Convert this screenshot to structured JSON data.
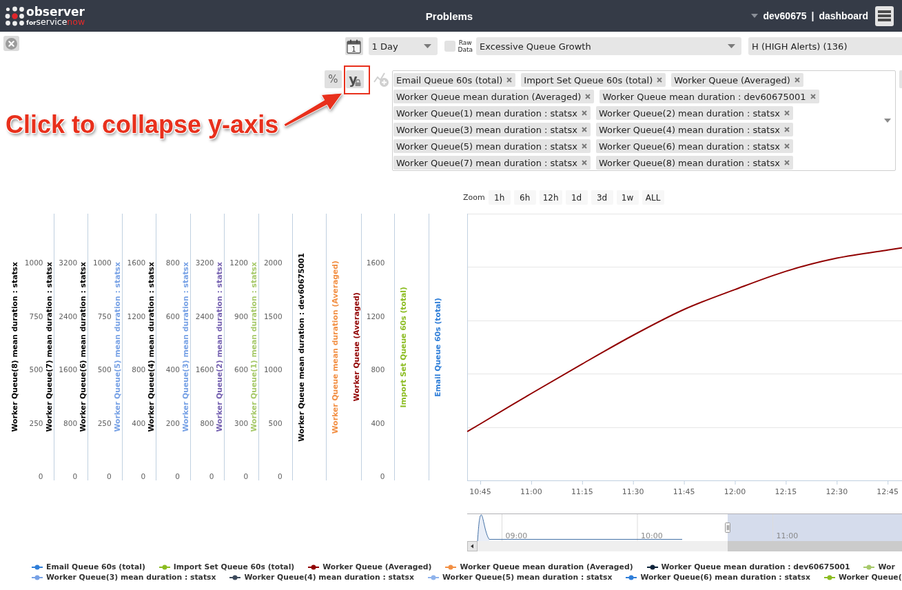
{
  "header": {
    "logo": {
      "wordmark": "observer",
      "tagline_prefix": "for",
      "tagline": "service",
      "tagline_accent": "now"
    },
    "title": "Problems",
    "user": "dev60675",
    "separator": "|",
    "link": "dashboard"
  },
  "filters": {
    "calendar_day": "1",
    "period": "1 Day",
    "raw_data": {
      "label": "Raw Data",
      "checked": false
    },
    "problem": "Excessive Queue Growth",
    "severity": "H (HIGH Alerts) (136)"
  },
  "series_tools": {
    "percent": "%",
    "y_axis": "y",
    "add_series": {
      "disabled": true
    },
    "selected_series": [
      "Email Queue 60s (total)",
      "Import Set Queue 60s (total)",
      "Worker Queue (Averaged)",
      "Worker Queue mean duration (Averaged)",
      "Worker Queue mean duration : dev60675001",
      "Worker Queue(1) mean duration : statsx",
      "Worker Queue(2) mean duration : statsx",
      "Worker Queue(3) mean duration : statsx",
      "Worker Queue(4) mean duration : statsx",
      "Worker Queue(5) mean duration : statsx",
      "Worker Queue(6) mean duration : statsx",
      "Worker Queue(7) mean duration : statsx",
      "Worker Queue(8) mean duration : statsx"
    ]
  },
  "annotation": {
    "text": "Click to collapse y-axis"
  },
  "chart": {
    "zoom_label": "Zoom",
    "zoom_buttons": [
      {
        "label": "1h",
        "selected": false
      },
      {
        "label": "6h",
        "selected": false
      },
      {
        "label": "12h",
        "selected": false
      },
      {
        "label": "1d",
        "selected": false
      },
      {
        "label": "3d",
        "selected": false
      },
      {
        "label": "1w",
        "selected": false
      },
      {
        "label": "ALL",
        "selected": false
      }
    ],
    "y_axes": [
      {
        "kind": "scale",
        "title": "Worker Queue(8) mean duration : statsx",
        "color": "#000000",
        "ticks": [
          "1000",
          "750",
          "500",
          "250",
          "0"
        ]
      },
      {
        "kind": "scale",
        "title": "Worker Queue(7) mean duration : statsx",
        "color": "#000000",
        "ticks": [
          "3200",
          "2400",
          "1600",
          "800",
          "0"
        ]
      },
      {
        "kind": "scale",
        "title": "Worker Queue(6) mean duration : statsx",
        "color": "#000000",
        "ticks": [
          "1000",
          "750",
          "500",
          "250",
          "0"
        ]
      },
      {
        "kind": "scale",
        "title": "Worker Queue(5) mean duration : statsx",
        "color": "#77a1e5",
        "ticks": [
          "1600",
          "1200",
          "800",
          "400",
          "0"
        ]
      },
      {
        "kind": "scale",
        "title": "Worker Queue(4) mean duration : statsx",
        "color": "#000000",
        "ticks": [
          "800",
          "600",
          "400",
          "200",
          "0"
        ]
      },
      {
        "kind": "scale",
        "title": "Worker Queue(3) mean duration : statsx",
        "color": "#77a1e5",
        "ticks": [
          "3200",
          "2400",
          "1600",
          "800",
          "0"
        ]
      },
      {
        "kind": "scale",
        "title": "Worker Queue(2) mean duration : statsx",
        "color": "#7460b0",
        "ticks": [
          "1200",
          "900",
          "600",
          "300",
          "0"
        ]
      },
      {
        "kind": "scale",
        "title": "Worker Queue(1) mean duration : statsx",
        "color": "#a6c96a",
        "ticks": [
          "2000",
          "1500",
          "1000",
          "500",
          "0"
        ]
      },
      {
        "kind": "plain",
        "title": "Worker Queue mean duration : dev60675001",
        "color": "#000000"
      },
      {
        "kind": "plain",
        "title": "Worker Queue mean duration (Averaged)",
        "color": "#f28f43"
      },
      {
        "kind": "scale",
        "title": "Worker Queue (Averaged)",
        "color": "#910000",
        "ticks": [
          "1600",
          "1200",
          "800",
          "400",
          "0"
        ]
      },
      {
        "kind": "plain",
        "title": "Import Set Queue 60s (total)",
        "color": "#8bbc21"
      },
      {
        "kind": "plain",
        "title": "Email Queue 60s (total)",
        "color": "#2f7ed8"
      }
    ],
    "plot": {
      "x_labels": [
        "10:45",
        "11:00",
        "11:15",
        "11:30",
        "11:45",
        "12:00",
        "12:15",
        "12:30",
        "12:45"
      ]
    },
    "navigator": {
      "labels": [
        "09:00",
        "10:00",
        "11:00"
      ]
    },
    "legend": {
      "rows": [
        {
          "items": [
            {
              "label": "Email Queue 60s (total)",
              "color": "#2f7ed8"
            },
            {
              "label": "Import Set Queue 60s (total)",
              "color": "#8bbc21"
            },
            {
              "label": "Worker Queue (Averaged)",
              "color": "#910000"
            },
            {
              "label": "Worker Queue mean duration (Averaged)",
              "color": "#f28f43"
            },
            {
              "label": "Worker Queue mean duration : dev60675001",
              "color": "#0d233a"
            },
            {
              "label": "Wor",
              "color": "#a6c96a"
            }
          ]
        },
        {
          "items": [
            {
              "label": "Worker Queue(3) mean duration : statsx",
              "color": "#77a1e5"
            },
            {
              "label": "Worker Queue(4) mean duration : statsx",
              "color": "#3d4a5c"
            },
            {
              "label": "Worker Queue(5) mean duration : statsx",
              "color": "#8fb3ec"
            },
            {
              "label": "Worker Queue(6) mean duration : statsx",
              "color": "#2f7ed8"
            },
            {
              "label": "Worker Queue(",
              "color": "#8bbc21"
            }
          ]
        }
      ]
    }
  }
}
